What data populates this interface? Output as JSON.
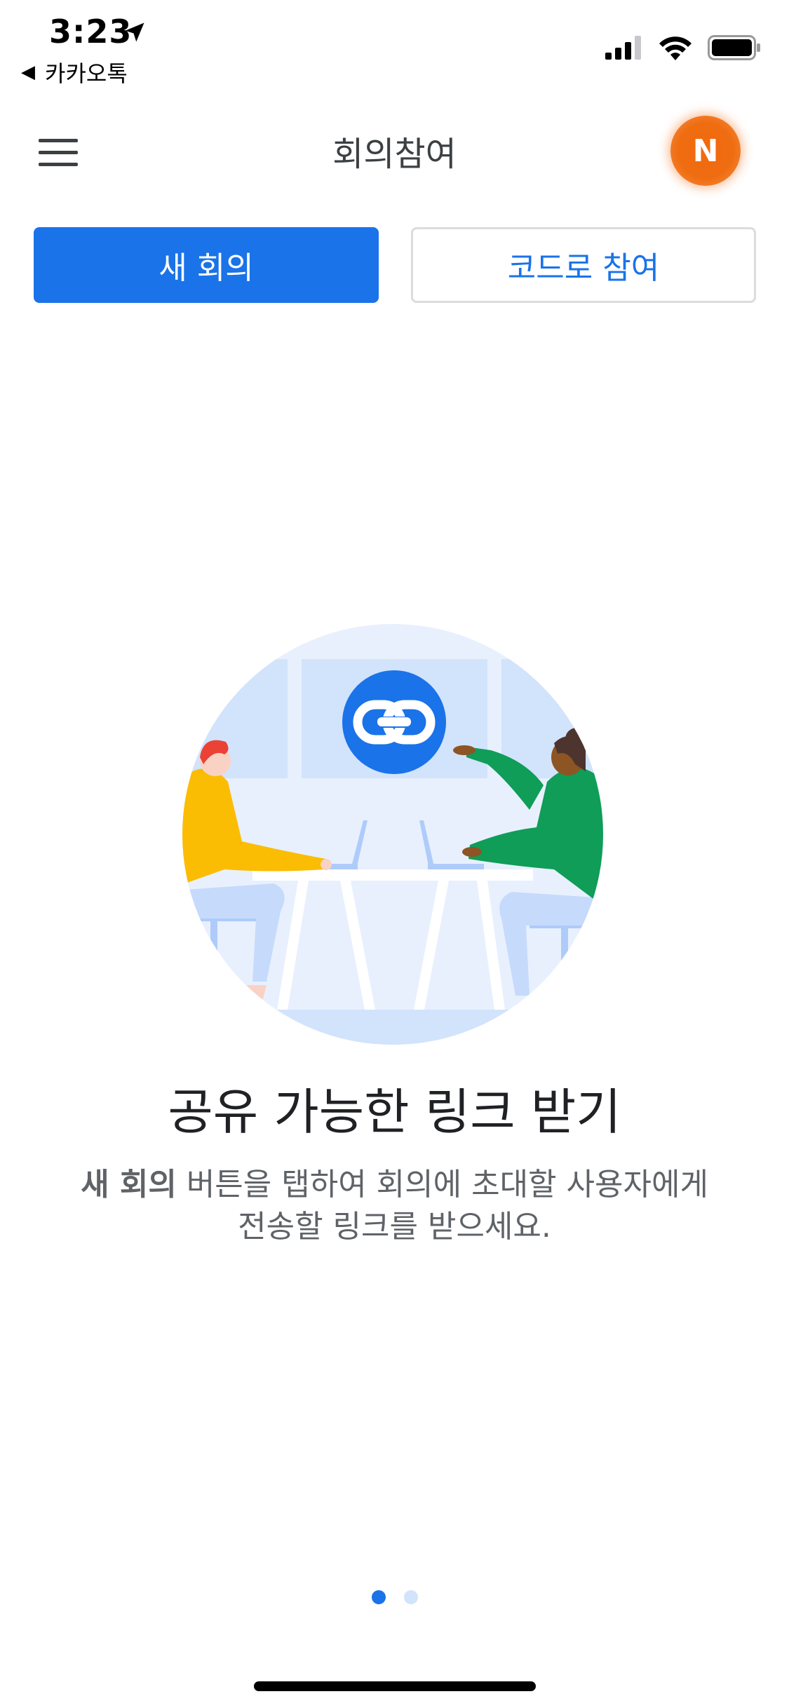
{
  "status_bar": {
    "time": "3:23",
    "back_app": "카카오톡",
    "icons": [
      "location-arrow-icon",
      "cellular-signal-icon",
      "wifi-icon",
      "battery-icon"
    ]
  },
  "app_bar": {
    "title": "회의참여",
    "avatar_initial": "N",
    "menu_icon": "hamburger-menu-icon"
  },
  "actions": {
    "new_meeting": "새 회의",
    "join_with_code": "코드로 참여"
  },
  "onboarding": {
    "headline": "공유 가능한 링크 받기",
    "desc_bold": "새 회의",
    "desc_rest_line1": " 버튼을 탭하여 회의에 초대할 사용자에게",
    "desc_line2": "전송할 링크를 받으세요.",
    "illustration_icon": "link-icon"
  },
  "pager": {
    "total": 2,
    "current": 1
  },
  "colors": {
    "primary": "#1a73e8",
    "avatar": "#ef6c10",
    "text_primary": "#202124",
    "text_secondary": "#5f6368"
  }
}
